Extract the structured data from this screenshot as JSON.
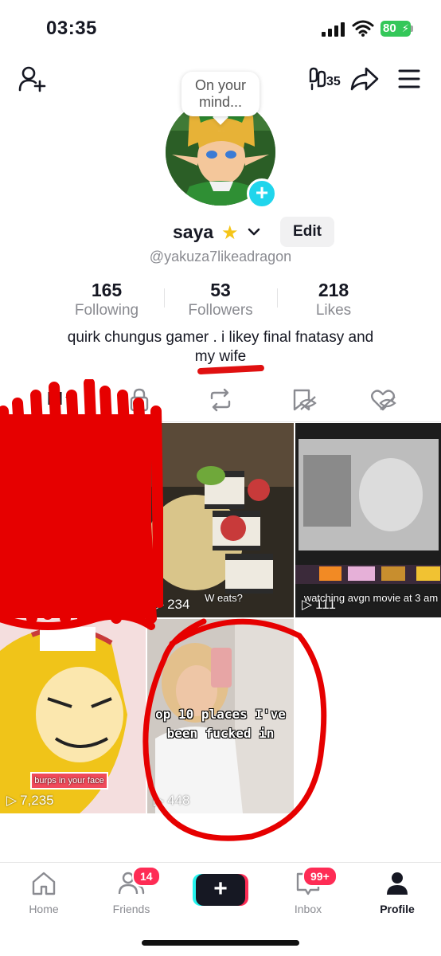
{
  "status": {
    "time": "03:35",
    "battery": "80"
  },
  "header": {
    "bubble_line1": "On your",
    "bubble_line2": "mind...",
    "analytics_badge": "35"
  },
  "profile": {
    "name": "saya",
    "edit_label": "Edit",
    "handle": "@yakuza7likeadragon",
    "bio_line1": "quirk chungus gamer . i likey final fnatasy and",
    "bio_line2": "my wife"
  },
  "stats": [
    {
      "value": "165",
      "label": "Following"
    },
    {
      "value": "53",
      "label": "Followers"
    },
    {
      "value": "218",
      "label": "Likes"
    }
  ],
  "videos": [
    {
      "views": "234",
      "caption": "W eats?"
    },
    {
      "views": "111",
      "caption": "watching avgn movie at 3 am"
    },
    {
      "views": "7,235",
      "caption": "burps in your face"
    },
    {
      "views": "448",
      "caption": "op 10 places I've been fucked in"
    }
  ],
  "bottom_nav": {
    "home": "Home",
    "friends": "Friends",
    "friends_badge": "14",
    "inbox": "Inbox",
    "inbox_badge": "99+",
    "profile": "Profile"
  },
  "colors": {
    "accent": "#fe2c55",
    "cyan": "#20d5ec",
    "annotation_red": "#e01010"
  }
}
